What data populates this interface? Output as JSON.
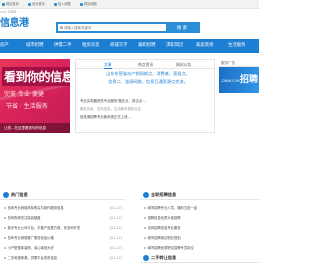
{
  "topbar": {
    "items": [
      "网站首页",
      "设为首页",
      "加入收藏",
      "网站地图"
    ]
  },
  "header": {
    "url_text": "cn1.1888",
    "site_name": "信息港",
    "search_placeholder": "请输入搜索关键词",
    "search_button": "搜 索"
  },
  "nav": {
    "items": [
      "房产",
      "城市招聘",
      "供需二手",
      "租房买卖",
      "商铺写字",
      "兼职招聘",
      "求职简历",
      "家居装修",
      "生活服务"
    ]
  },
  "banner": {
    "headline": "看到你的信息",
    "line2": "完美·专业·便捷",
    "line3": "节省 · 生活服务",
    "caption": "让您…在这里看到你的信息"
  },
  "news": {
    "tabs": [
      "文章",
      "热点资讯",
      "网站公告"
    ],
    "hot_lines": [
      "山东东营省岛产销网络点，消费者、直投点，",
      "信息二、连接网络，信息互通资源点交流，"
    ],
    "list": [
      {
        "text": "专业买电器把关专业服务·搬迁点，到达点·…",
        "sub": false
      },
      {
        "text": "服务买卖，发布信息，生活服务便民社区",
        "sub": true
      },
      {
        "text": "信息港招聘专业新系统正式上线…",
        "sub": false
      }
    ]
  },
  "right_ad": {
    "label": "服务广告",
    "small": "12806.COM",
    "big": "招聘"
  },
  "left_section": {
    "title": "热门信息",
    "items": [
      {
        "text": "岛屿专业网络商标购买与制作服务信息",
        "date": "[01-27]"
      },
      {
        "text": "岛屿购房关注精品楼盘",
        "date": "[01-27]"
      },
      {
        "text": "新手专业公司平台，平稳产品更方便，多岛屿开发",
        "date": "[01-27]"
      },
      {
        "text": "岛屿专业网络推广服务信息价格",
        "date": "[01-27]"
      },
      {
        "text": "小户型整体装修，省心省钱大好",
        "date": "[01-27]"
      },
      {
        "text": "二手房源房源，供需平台发布信息",
        "date": "[01-27]"
      }
    ]
  },
  "right_section": {
    "title": "全职招聘信息",
    "items": [
      "城市招聘专业人员，福利五险一金",
      "招聘信息优质大量招聘",
      "岛屿招聘信息专业服务",
      "城市招聘岗位职业规划",
      "城市招聘优质职位招聘专员岗位",
      "岛屿专业网络招聘人才信息"
    ]
  },
  "second_hand": {
    "title": "二手转让信息"
  }
}
